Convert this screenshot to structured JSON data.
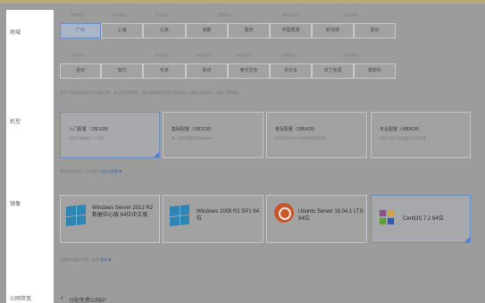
{
  "sidebar": {
    "labels": [
      "地域",
      "机型",
      "镜像",
      "公网带宽"
    ]
  },
  "region_groups": {
    "row1": [
      "华南地区",
      "华东地区",
      "华北地区",
      "西南地区",
      "港澳台地区",
      "亚太东南"
    ],
    "row2": [
      "亚太东北",
      "亚太南部",
      "美国西部",
      "美国东部",
      "北美地区",
      "欧洲地区"
    ]
  },
  "regions": {
    "row1": [
      "广州",
      "上海",
      "北京",
      "成都",
      "重庆",
      "中国香港",
      "新加坡",
      "曼谷"
    ],
    "row2": [
      "孟买",
      "首尔",
      "东京",
      "硅谷",
      "弗吉尼亚",
      "多伦多",
      "法兰克福",
      "莫斯科"
    ],
    "selected": "广州"
  },
  "region_note": "处在不同地域的云产品内网不通，购买后不能更换。建议选择靠近您客户的地域，以降低访问延时，提高下载速度",
  "configs": [
    {
      "title": "入门配置（1核1GB）",
      "desc": "适用于初级的个人网站",
      "selected": true
    },
    {
      "title": "基础配置（1核2GB）",
      "desc": "有一定访问量的网站或APP",
      "selected": false
    },
    {
      "title": "普及配置（2核4GB）",
      "desc": "并发适中的APP或普通数据处理",
      "selected": false
    },
    {
      "title": "专业配置（4核8GB）",
      "desc": "适用于较大访问量的业务场景",
      "selected": false
    }
  ],
  "config_note": {
    "text": "更多机型配置，可以选择",
    "link": "自定义配置"
  },
  "images": [
    {
      "title": "Windows Server 2012 R2 数据中心版 64位中文版",
      "icon": "windows-icon",
      "selected": false
    },
    {
      "title": "Windows 2008 R2 SP1 64位",
      "icon": "windows-icon",
      "selected": false
    },
    {
      "title": "Ubuntu Server 16.04.1 LTS 64位",
      "icon": "ubuntu-icon",
      "selected": false
    },
    {
      "title": "CentOS 7.2 64位",
      "icon": "centos-icon",
      "selected": true
    }
  ],
  "image_note": {
    "text": "如需其他操作系统，选择",
    "link": "更多"
  },
  "bandwidth": {
    "checkbox_label": "分配免费公网IP",
    "checked": true
  },
  "colors": {
    "accent": "#4a7fd0",
    "windows": "#2f86b4",
    "ubuntu": "#c45a2c"
  }
}
